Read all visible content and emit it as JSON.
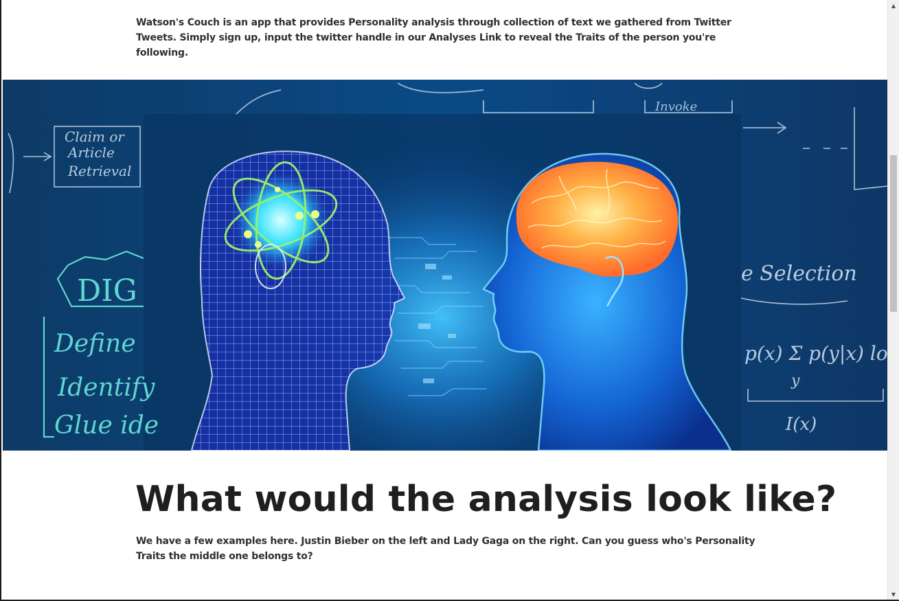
{
  "intro": {
    "text": "Watson's Couch is an app that provides Personality analysis through collection of text we gathered from Twitter Tweets. Simply sign up, input the twitter handle in our Analyses Link to reveal the Traits of the person you're following."
  },
  "hero": {
    "image_name": "ai-brain-vs-human-brain",
    "board_text_left": [
      "Claim or",
      "Article",
      "Retrieval",
      "DIG",
      "Define",
      "Identify",
      "Glue ide"
    ],
    "board_text_right": [
      "e Selection",
      "p(x) Σ p(y|x) log",
      "y",
      "I(x)"
    ],
    "board_text_top": [
      "Invoke"
    ]
  },
  "section": {
    "heading": "What would the analysis look like?",
    "text": "We have a few examples here. Justin Bieber on the left and Lady Gaga on the right. Can you guess who's Personality Traits the middle one belongs to?"
  },
  "scrollbar": {
    "up_icon": "triangle-up",
    "down_icon": "triangle-down",
    "up_glyph": "▲",
    "down_glyph": "▼"
  },
  "colors": {
    "text": "#2f2f2f",
    "heading": "#1f1f1f",
    "hero_bg": "#0c3563",
    "chalk": "#5fd6d0"
  }
}
